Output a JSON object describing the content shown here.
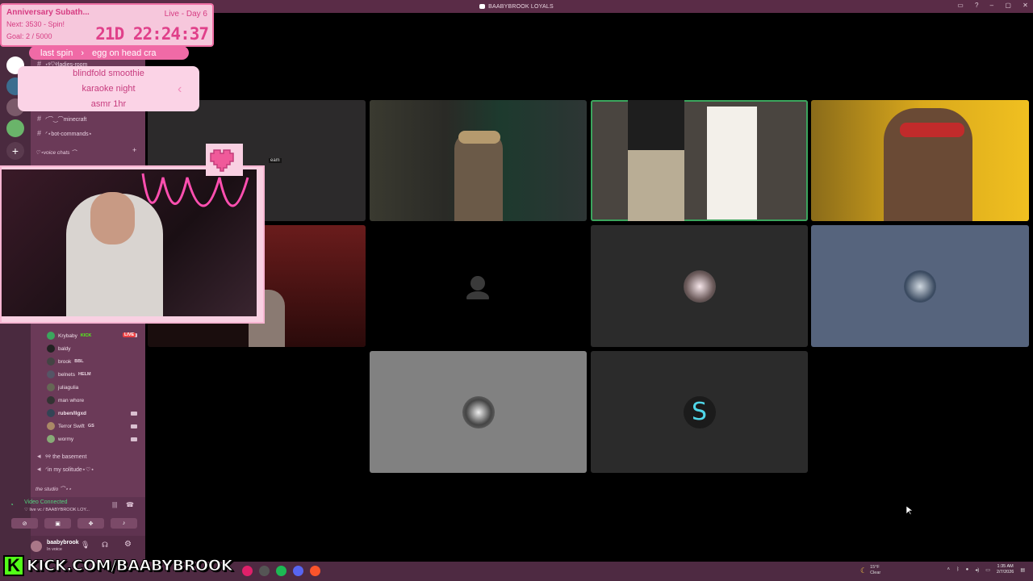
{
  "window": {
    "title": "BAABYBROOK LOYALS",
    "controls": [
      "–",
      "▢",
      "✕"
    ]
  },
  "subathon": {
    "title": "Anniversary Subath...",
    "day": "Live - Day 6",
    "next": "Next: 3530 - Spin!",
    "goal": "Goal: 2 / 5000",
    "timer": "21D  22:24:37",
    "last_spin_label": "last spin",
    "last_spin_arrow": "›",
    "last_spin_value": "egg on head cra",
    "spin_items": [
      "blindfold smoothie",
      "karaoke night",
      "asmr 1hr"
    ],
    "spin_arrow": "‹"
  },
  "sidebar": {
    "channels": [
      {
        "name": "⋆୨♡୧ladies-room",
        "icon": "hash-icon"
      },
      {
        "name": "ᐟ⌒‿⌒minecraft",
        "icon": "hash-icon"
      },
      {
        "name": "ᐟ⋆bot-commands⋆",
        "icon": "hash-icon"
      }
    ],
    "voice_category": "♡⋆voice chats ⌒",
    "voice_users": [
      {
        "name": "Krybaby",
        "tag": "KICK",
        "live": "LIVE"
      },
      {
        "name": "baldy",
        "tag": ""
      },
      {
        "name": "brook",
        "tag": "BBL"
      },
      {
        "name": "belnets",
        "tag": "HELM"
      },
      {
        "name": "juliagulia",
        "tag": ""
      },
      {
        "name": "man whore",
        "tag": ""
      },
      {
        "name": "ruben/llgxd",
        "tag": ""
      },
      {
        "name": "Terror Swift",
        "tag": "GS"
      },
      {
        "name": "wormy",
        "tag": ""
      }
    ],
    "voice_channels": [
      "୨୧ the basement",
      "ᐟin my solitude⋆♡⋆"
    ],
    "studio_category": "the studio ⌒⋆⋆",
    "voice_status": "Video Connected",
    "voice_status_sub": "♡ live vc / BAABYBROOK LOY...",
    "username": "baabybrook",
    "user_status": "In voice"
  },
  "grid": {
    "stream_label": "eam"
  },
  "kick": {
    "letter": "K",
    "url": "KICK.COM/BAABYBROOK"
  },
  "taskbar": {
    "weather_temp": "15°F",
    "weather_desc": "Clear",
    "time": "1:35 AM",
    "date": "2/7/2026"
  },
  "colors": {
    "sidebar_bg": "#6b3a58",
    "titlebar_bg": "#5a2c47",
    "accent_pink": "#f06aa6",
    "speaking_green": "#3ba55d",
    "kick_green": "#53fc18"
  }
}
